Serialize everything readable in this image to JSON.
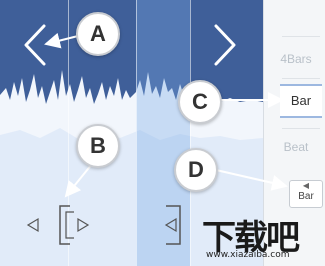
{
  "callouts": {
    "a": "A",
    "b": "B",
    "c": "C",
    "d": "D"
  },
  "side_panel": {
    "opt_4bars": "4Bars",
    "opt_bar": "Bar",
    "opt_beat": "Beat",
    "small_bar_label": "Bar"
  },
  "watermark": {
    "main": "下载吧",
    "sub": "www.xiazaiba.com"
  },
  "colors": {
    "wave_dark": "#3f5f99",
    "wave_light": "#eaf2fb",
    "selection": "#8fb3e3"
  }
}
